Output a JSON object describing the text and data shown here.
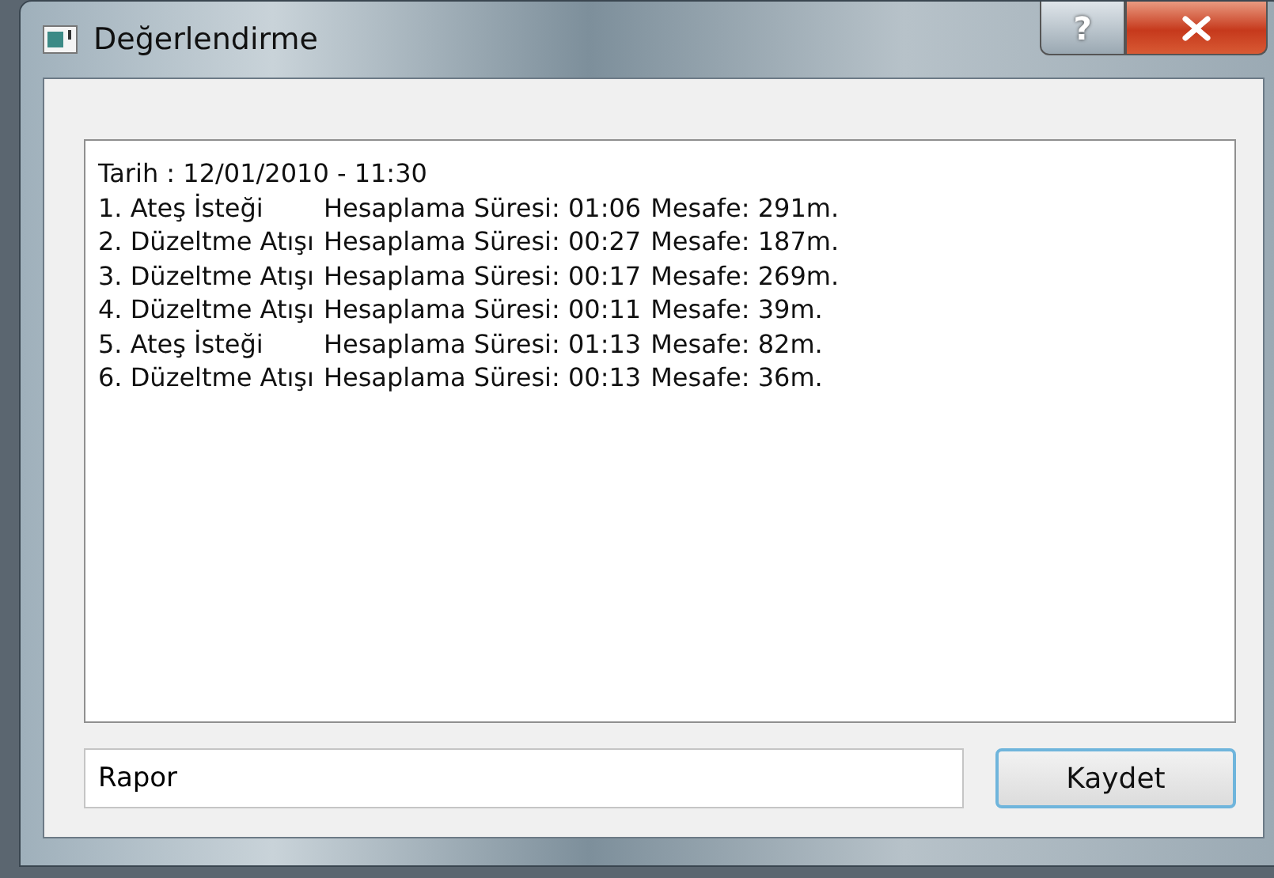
{
  "window": {
    "title": "Değerlendirme",
    "help_button": "?"
  },
  "report": {
    "header": "Tarih : 12/01/2010 - 11:30",
    "rows": [
      {
        "name": "1. Ateş İsteği",
        "duration": "Hesaplama Süresi: 01:06",
        "distance": "Mesafe: 291m."
      },
      {
        "name": "2. Düzeltme Atışı",
        "duration": "Hesaplama Süresi: 00:27",
        "distance": "Mesafe: 187m."
      },
      {
        "name": "3. Düzeltme Atışı",
        "duration": "Hesaplama Süresi: 00:17",
        "distance": "Mesafe: 269m."
      },
      {
        "name": "4. Düzeltme Atışı",
        "duration": "Hesaplama Süresi: 00:11",
        "distance": "Mesafe: 39m."
      },
      {
        "name": "5. Ateş İsteği",
        "duration": "Hesaplama Süresi: 01:13",
        "distance": "Mesafe: 82m."
      },
      {
        "name": "6. Düzeltme Atışı",
        "duration": "Hesaplama Süresi: 00:13",
        "distance": "Mesafe: 36m."
      }
    ]
  },
  "file_name": {
    "value": "Rapor"
  },
  "save_button": "Kaydet"
}
